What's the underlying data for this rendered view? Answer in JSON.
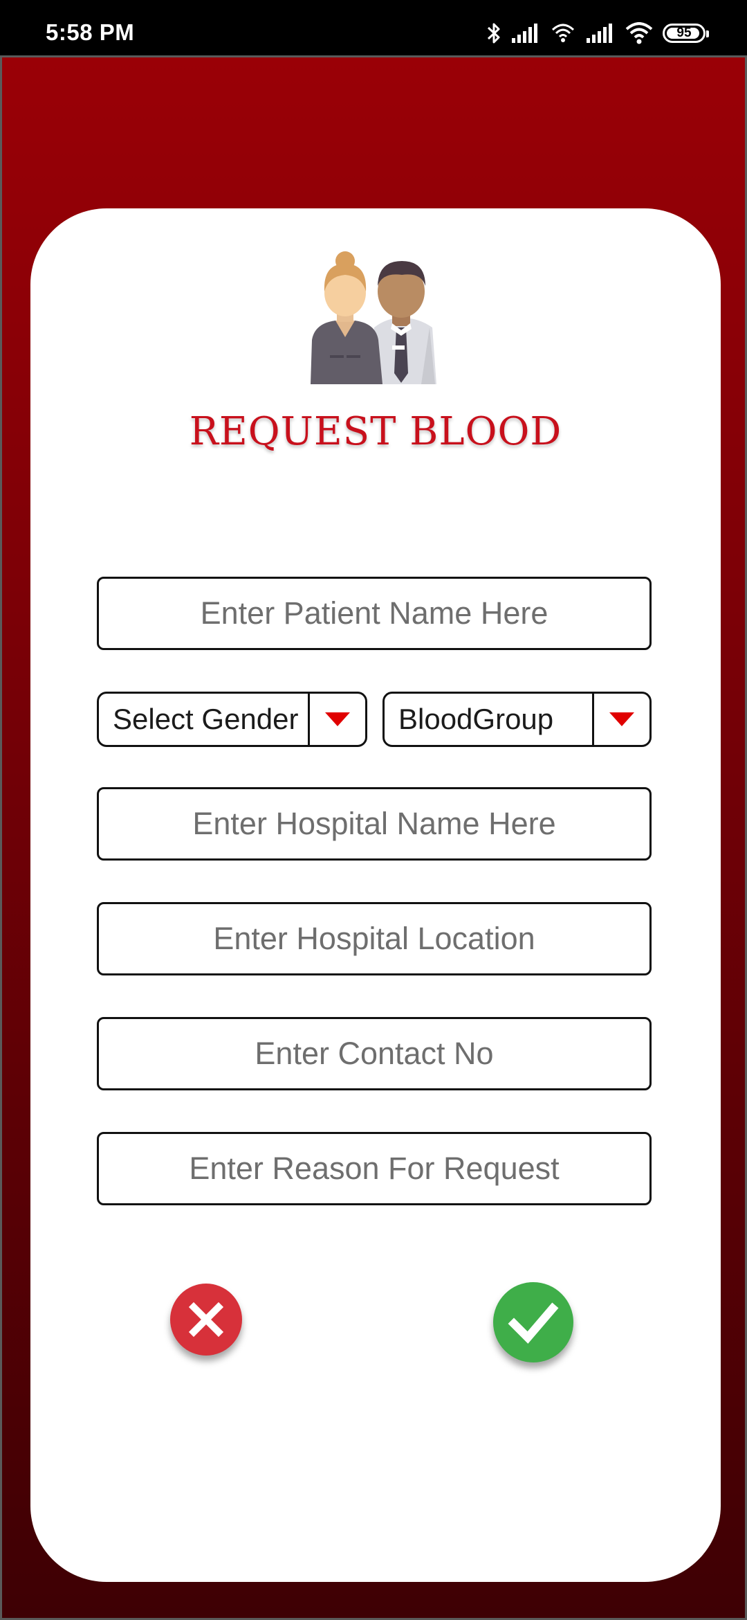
{
  "status_bar": {
    "time": "5:58 PM",
    "battery": "95",
    "icons": [
      "bluetooth-icon",
      "signal-icon",
      "hotspot-icon",
      "signal-icon",
      "wifi-icon",
      "battery-icon"
    ]
  },
  "page": {
    "title": "REQUEST BLOOD",
    "illustration": "people-icon"
  },
  "form": {
    "patient_name_placeholder": "Enter Patient Name Here",
    "gender_select": "Select Gender",
    "blood_group_select": "BloodGroup",
    "hospital_name_placeholder": "Enter Hospital Name Here",
    "hospital_location_placeholder": "Enter Hospital Location",
    "contact_placeholder": "Enter Contact No",
    "reason_placeholder": "Enter Reason For Request"
  },
  "actions": {
    "cancel_icon": "close-icon",
    "confirm_icon": "check-icon"
  },
  "colors": {
    "background_top": "#9a0006",
    "background_bottom": "#3e0004",
    "title": "#c8101c",
    "cancel": "#d7313a",
    "confirm": "#3fae49",
    "dropdown_arrow": "#e00000"
  }
}
